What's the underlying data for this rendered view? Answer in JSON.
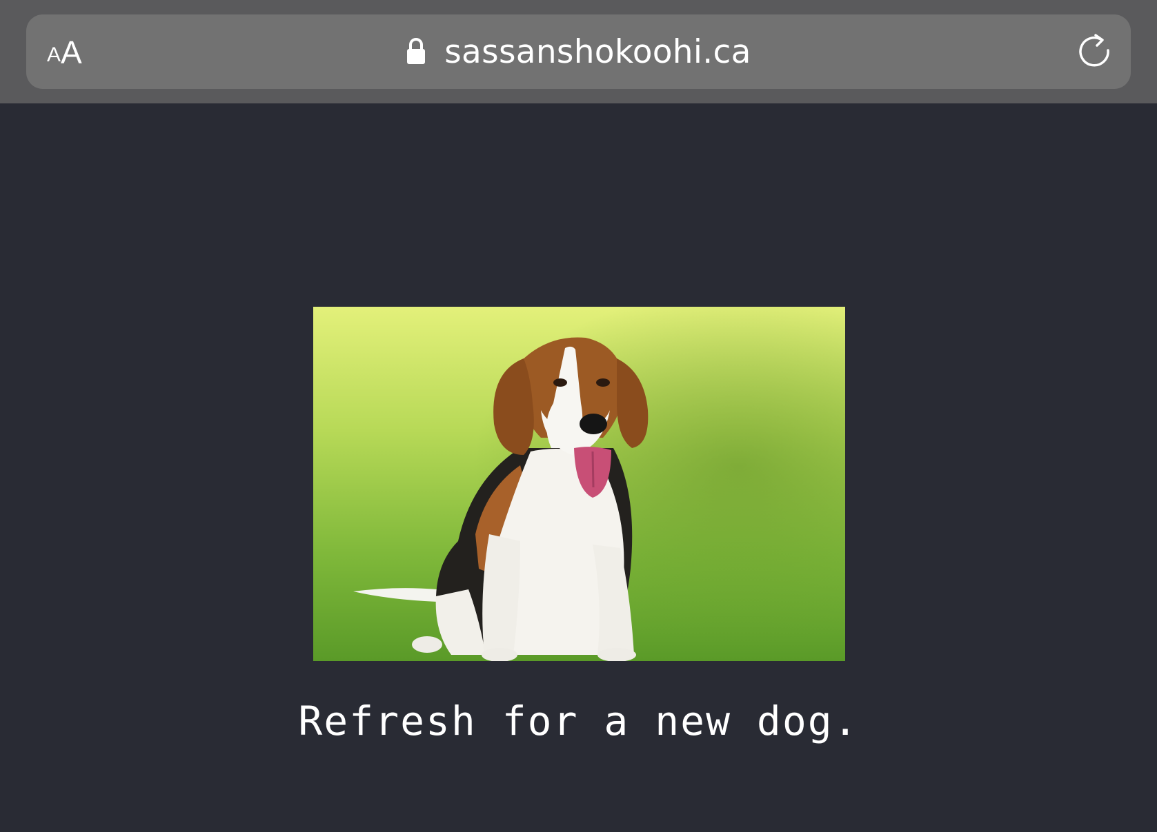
{
  "browser": {
    "reader_button": {
      "small": "A",
      "big": "A"
    },
    "url": "sassanshokoohi.ca",
    "icons": {
      "lock": "lock-icon",
      "reload": "reload-icon"
    }
  },
  "page": {
    "image_alt": "dog-photo",
    "caption": "Refresh for a new dog."
  },
  "colors": {
    "page_background": "#292b34",
    "toolbar_background": "#5a5a5c",
    "url_field": "#727272",
    "text": "#ffffff"
  }
}
